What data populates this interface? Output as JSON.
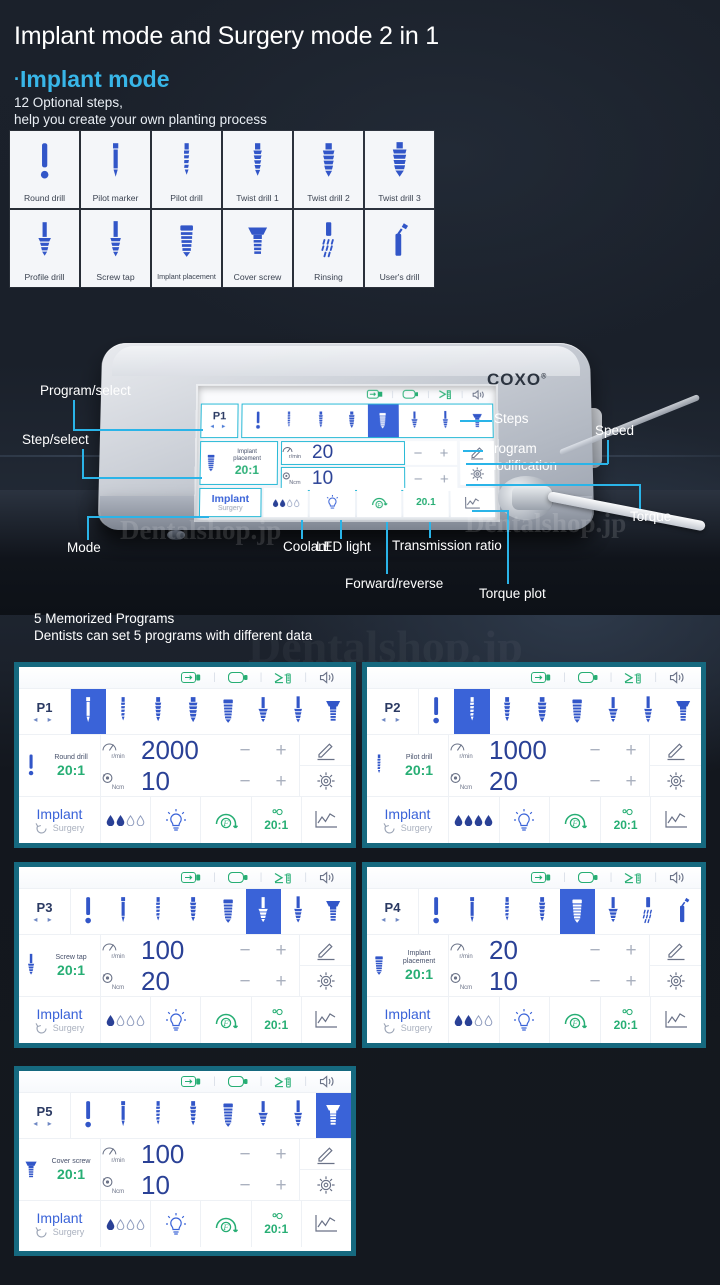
{
  "header": {
    "title": "Implant mode and Surgery mode 2 in 1",
    "subtitle_bullet": "·",
    "subtitle": "Implant mode",
    "line1": "12 Optional steps,",
    "line2": "help you create your own planting process"
  },
  "drill_grid": [
    {
      "label": "Round drill",
      "icon": "round-drill-icon"
    },
    {
      "label": "Pilot marker",
      "icon": "pilot-marker-icon"
    },
    {
      "label": "Pilot drill",
      "icon": "pilot-drill-icon"
    },
    {
      "label": "Twist drill 1",
      "icon": "twist-drill-1-icon"
    },
    {
      "label": "Twist drill 2",
      "icon": "twist-drill-2-icon"
    },
    {
      "label": "Twist drill 3",
      "icon": "twist-drill-3-icon"
    },
    {
      "label": "Profile drill",
      "icon": "profile-drill-icon"
    },
    {
      "label": "Screw tap",
      "icon": "screw-tap-icon"
    },
    {
      "label": "Implant placement",
      "icon": "implant-placement-icon"
    },
    {
      "label": "Cover screw",
      "icon": "cover-screw-icon"
    },
    {
      "label": "Rinsing",
      "icon": "rinsing-icon"
    },
    {
      "label": "User's drill",
      "icon": "users-drill-icon"
    }
  ],
  "device": {
    "brand": "COXO",
    "brand_reg": "®",
    "screen": {
      "program": "P1",
      "arrows": "◂ ▸",
      "tool_name_line1": "Implant",
      "tool_name_line2": "placement",
      "ratio": "20:1",
      "speed_unit": "r/min",
      "speed_value": "20",
      "torque_unit": "Ncm",
      "torque_value": "10",
      "minus": "−",
      "plus": "+",
      "mode_main": "Implant",
      "mode_sub": "Surgery",
      "gear_ratio": "20.1"
    },
    "callouts": {
      "program_select": "Program/select",
      "step_select": "Step/select",
      "mode": "Mode",
      "coolant": "Coolant",
      "led_light": "LED light",
      "forward_reverse": "Forward/reverse",
      "transmission_ratio": "Transmission ratio",
      "torque_plot": "Torque plot",
      "steps": "Steps",
      "program_modification_l1": "Program",
      "program_modification_l2": "modification",
      "speed": "Speed",
      "torque": "Torque"
    }
  },
  "memorized": {
    "title": "5 Memorized Programs",
    "desc": "Dentists can set 5 programs with different data"
  },
  "watermarks": {
    "small": "Dentalshop.jp",
    "large": "Dentalshop.jp"
  },
  "common": {
    "minus": "−",
    "plus": "+",
    "arrows": "◂ ▸",
    "speed_unit": "r/min",
    "torque_unit": "Ncm",
    "mode_main": "Implant",
    "mode_sub": "Surgery",
    "ratio_bottom": "20:1"
  },
  "programs": [
    {
      "id": "P1",
      "tool_label": "Round drill",
      "tool_icon": "round-drill-icon",
      "ratio": "20:1",
      "speed": "2000",
      "torque": "10",
      "active_step": 0,
      "coolant_filled": 2,
      "coolant_total": 4,
      "steps": [
        "pilot-marker-icon",
        "pilot-drill-icon",
        "twist-drill-1-icon",
        "twist-drill-2-icon",
        "implant-placement-icon",
        "profile-drill-icon",
        "screw-tap-icon",
        "cover-screw-icon"
      ],
      "first_step_icon": "round-drill-icon"
    },
    {
      "id": "P2",
      "tool_label": "Pilot drill",
      "tool_icon": "pilot-drill-icon",
      "ratio": "20:1",
      "speed": "1000",
      "torque": "20",
      "active_step": 1,
      "coolant_filled": 4,
      "coolant_total": 4,
      "steps": [
        "round-drill-icon",
        "pilot-drill-icon",
        "twist-drill-1-icon",
        "twist-drill-2-icon",
        "implant-placement-icon",
        "profile-drill-icon",
        "screw-tap-icon",
        "cover-screw-icon"
      ],
      "first_step_icon": "round-drill-icon"
    },
    {
      "id": "P3",
      "tool_label": "Screw tap",
      "tool_icon": "screw-tap-icon",
      "ratio": "20:1",
      "speed": "100",
      "torque": "20",
      "active_step": 5,
      "coolant_filled": 1,
      "coolant_total": 4,
      "steps": [
        "round-drill-icon",
        "pilot-marker-icon",
        "pilot-drill-icon",
        "twist-drill-1-icon",
        "implant-placement-icon",
        "profile-drill-icon",
        "screw-tap-icon",
        "cover-screw-icon"
      ],
      "first_step_icon": "round-drill-icon"
    },
    {
      "id": "P4",
      "tool_label_l1": "Implant",
      "tool_label_l2": "placement",
      "tool_label": "Implant placement",
      "tool_icon": "implant-placement-icon",
      "ratio": "20:1",
      "speed": "20",
      "torque": "10",
      "active_step": 4,
      "coolant_filled": 2,
      "coolant_total": 4,
      "steps": [
        "round-drill-icon",
        "pilot-marker-icon",
        "pilot-drill-icon",
        "twist-drill-1-icon",
        "implant-placement-icon",
        "profile-drill-icon",
        "rinsing-icon",
        "users-drill-icon"
      ],
      "first_step_icon": "round-drill-icon"
    },
    {
      "id": "P5",
      "tool_label": "Cover screw",
      "tool_icon": "cover-screw-icon",
      "ratio": "20:1",
      "speed": "100",
      "torque": "10",
      "active_step": 7,
      "coolant_filled": 1,
      "coolant_total": 4,
      "steps": [
        "round-drill-icon",
        "pilot-marker-icon",
        "pilot-drill-icon",
        "twist-drill-1-icon",
        "implant-placement-icon",
        "profile-drill-icon",
        "screw-tap-icon",
        "cover-screw-icon"
      ],
      "first_step_icon": "round-drill-icon"
    }
  ],
  "colors": {
    "accent_cyan": "#38b6e8",
    "panel_border": "#16697f",
    "active_blue": "#3a63d8",
    "icon_blue": "#3256c8",
    "green": "#27ae74",
    "value_blue": "#2a4196",
    "screen_border": "#27b9d6"
  }
}
